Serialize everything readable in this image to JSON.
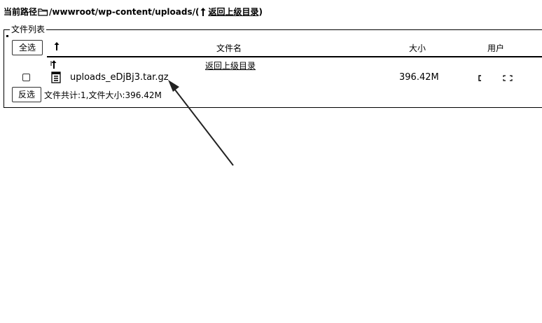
{
  "path": {
    "label": "当前路径",
    "folder_icon": "folder-icon",
    "value": "/wwwroot/wp-content/uploads/(",
    "up_icon": "up-arrow-icon",
    "parent_link": "返回上级目录",
    "close": ")"
  },
  "file_list": {
    "legend": "文件列表",
    "select_all_label": "全选",
    "invert_label": "反选",
    "sort_icon": "sort-up-arrow-icon",
    "columns": {
      "name": "文件名",
      "size": "大小",
      "user": "用户"
    },
    "parent_row": {
      "icon": "up-arrow-icon",
      "link": "返回上级目录"
    },
    "rows": [
      {
        "icon": "archive-file-icon",
        "name": "uploads_eDjBj3.tar.gz",
        "size": "396.42M",
        "checked": false
      }
    ],
    "summary": "文件共计:1,文件大小:396.42M"
  },
  "annotation": {
    "type": "arrow",
    "color": "#222222"
  }
}
